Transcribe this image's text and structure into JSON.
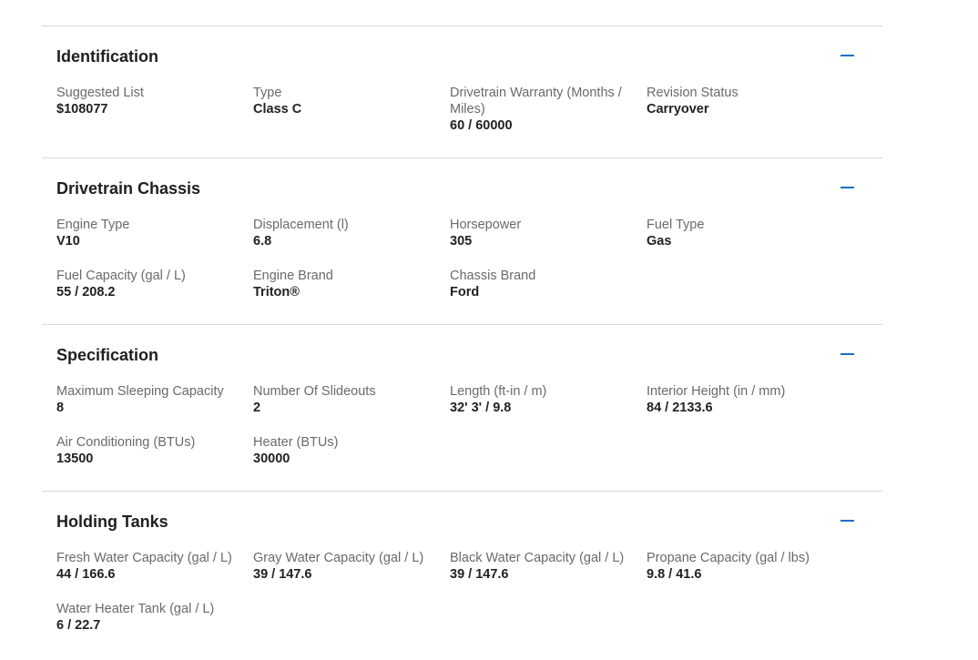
{
  "sections": [
    {
      "title": "Identification",
      "collapse_icon": "minus-icon",
      "fields": [
        {
          "label": "Suggested List",
          "value": "$108077"
        },
        {
          "label": "Type",
          "value": "Class C"
        },
        {
          "label": "Drivetrain Warranty (Months / Miles)",
          "value": "60 / 60000"
        },
        {
          "label": "Revision Status",
          "value": "Carryover"
        }
      ]
    },
    {
      "title": "Drivetrain Chassis",
      "collapse_icon": "minus-icon",
      "fields": [
        {
          "label": "Engine Type",
          "value": "V10"
        },
        {
          "label": "Displacement (l)",
          "value": "6.8"
        },
        {
          "label": "Horsepower",
          "value": "305"
        },
        {
          "label": "Fuel Type",
          "value": "Gas"
        },
        {
          "label": "Fuel Capacity (gal / L)",
          "value": "55 / 208.2"
        },
        {
          "label": "Engine Brand",
          "value": "Triton®"
        },
        {
          "label": "Chassis Brand",
          "value": "Ford"
        }
      ]
    },
    {
      "title": "Specification",
      "collapse_icon": "minus-icon",
      "fields": [
        {
          "label": "Maximum Sleeping Capacity",
          "value": "8"
        },
        {
          "label": "Number Of Slideouts",
          "value": "2"
        },
        {
          "label": "Length (ft-in / m)",
          "value": "32' 3' / 9.8"
        },
        {
          "label": "Interior Height (in / mm)",
          "value": "84 / 2133.6"
        },
        {
          "label": "Air Conditioning (BTUs)",
          "value": "13500"
        },
        {
          "label": "Heater (BTUs)",
          "value": "30000"
        }
      ]
    },
    {
      "title": "Holding Tanks",
      "collapse_icon": "minus-icon",
      "fields": [
        {
          "label": "Fresh Water Capacity (gal / L)",
          "value": "44 / 166.6"
        },
        {
          "label": "Gray Water Capacity (gal / L)",
          "value": "39 / 147.6"
        },
        {
          "label": "Black Water Capacity (gal / L)",
          "value": "39 / 147.6"
        },
        {
          "label": "Propane Capacity (gal / lbs)",
          "value": "9.8 / 41.6"
        },
        {
          "label": "Water Heater Tank (gal / L)",
          "value": "6 / 22.7"
        }
      ]
    }
  ],
  "colors": {
    "accent": "#1a6fc4",
    "divider": "#d9d9d9",
    "label": "#6a6a6a",
    "value": "#222222"
  }
}
